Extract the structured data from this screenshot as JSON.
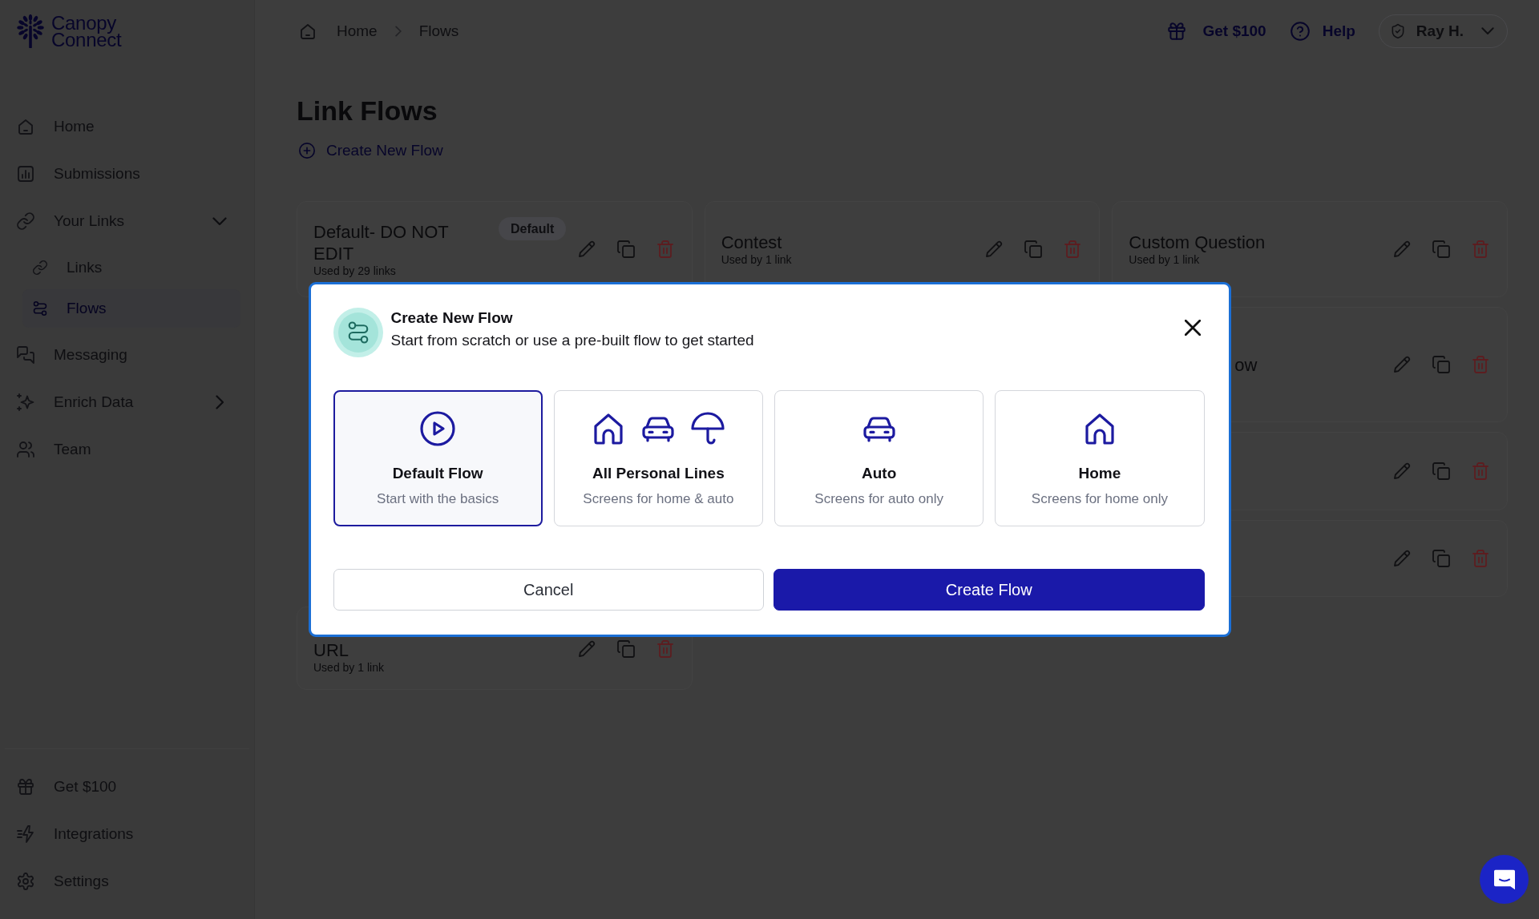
{
  "sidebar": {
    "logo": "Canopy Connect",
    "items": [
      {
        "label": "Home",
        "kind": "link",
        "selected": false
      },
      {
        "label": "Submissions",
        "kind": "link",
        "selected": false
      },
      {
        "label": "Your Links",
        "kind": "group",
        "expanded": true,
        "selected": false,
        "children": [
          {
            "label": "Links",
            "selected": false
          },
          {
            "label": "Flows",
            "selected": true
          }
        ]
      },
      {
        "label": "Messaging",
        "kind": "link",
        "selected": false
      },
      {
        "label": "Enrich Data",
        "kind": "group",
        "expanded": false,
        "selected": false
      },
      {
        "label": "Team",
        "kind": "link",
        "selected": false
      }
    ],
    "footer_items": [
      {
        "label": "Get $100",
        "selected": false
      },
      {
        "label": "Integrations",
        "selected": false
      },
      {
        "label": "Settings",
        "selected": false
      }
    ]
  },
  "topbar": {
    "breadcrumbs": [
      "Home",
      "Flows"
    ],
    "links": [
      "Get $100",
      "Help"
    ],
    "user": "Ray H."
  },
  "page": {
    "title": "Link Flows",
    "create_link": "Create New Flow",
    "flows": [
      {
        "kind": "flow",
        "title": "Default- DO NOT EDIT",
        "badge": "Default",
        "usage": "Used by 29 links"
      },
      {
        "kind": "flow",
        "title": "Contest",
        "usage": "Used by 1 link"
      },
      {
        "kind": "flow",
        "title": "Custom Question",
        "usage": "Used by 1 link"
      },
      {
        "kind": "flow",
        "title": "ow"
      },
      {
        "kind": "flow"
      },
      {
        "kind": "flow"
      },
      {
        "kind": "flow",
        "title": "URL",
        "usage": "Used by 1 link"
      }
    ]
  },
  "dialog": {
    "title": "Create New Flow",
    "subtitle": "Start from scratch or use a pre-built flow to get started",
    "options": [
      {
        "label": "Default Flow",
        "description": "Start with the basics",
        "selected": true
      },
      {
        "label": "All Personal Lines",
        "description": "Screens for home & auto",
        "selected": false
      },
      {
        "label": "Auto",
        "description": "Screens for auto only",
        "selected": false
      },
      {
        "label": "Home",
        "description": "Screens for home only",
        "selected": false
      }
    ],
    "buttons": [
      {
        "label": "Cancel",
        "kind": "secondary"
      },
      {
        "label": "Create Flow",
        "kind": "primary"
      }
    ]
  }
}
